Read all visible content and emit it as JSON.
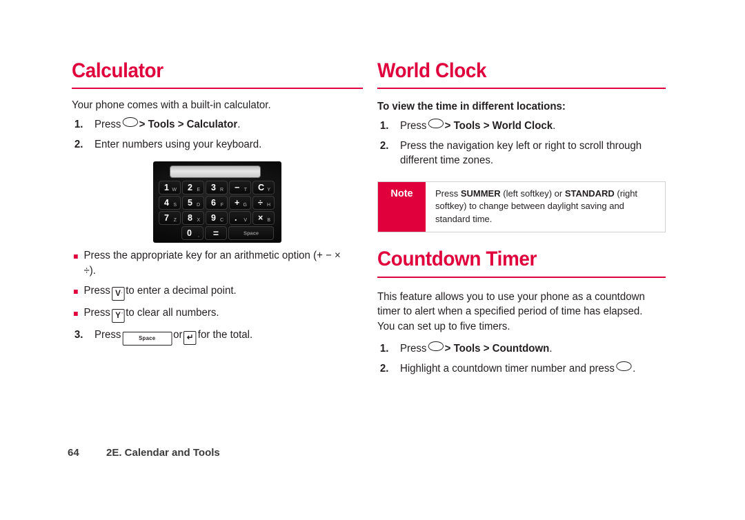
{
  "accent_color": "#e0003c",
  "left_column": {
    "heading": "Calculator",
    "intro": "Your phone comes with a built-in calculator.",
    "steps": [
      {
        "num": "1.",
        "prefix": "Press",
        "icon": "ok-key-icon",
        "path": "> Tools > Calculator",
        "suffix": "."
      },
      {
        "num": "2.",
        "text": "Enter numbers using your keyboard."
      }
    ],
    "keypad": {
      "display_value": "",
      "rows": [
        [
          {
            "main": "1",
            "sub": "W"
          },
          {
            "main": "2",
            "sub": "E"
          },
          {
            "main": "3",
            "sub": "R"
          },
          {
            "main": "−",
            "sub": "T"
          },
          {
            "main": "C",
            "sub": "Y"
          }
        ],
        [
          {
            "main": "4",
            "sub": "S"
          },
          {
            "main": "5",
            "sub": "D"
          },
          {
            "main": "6",
            "sub": "F"
          },
          {
            "main": "+",
            "sub": "G"
          },
          {
            "main": "÷",
            "sub": "H"
          }
        ],
        [
          {
            "main": "7",
            "sub": "Z"
          },
          {
            "main": "8",
            "sub": "X"
          },
          {
            "main": "9",
            "sub": "C"
          },
          {
            "main": ".",
            "sub": "V"
          },
          {
            "main": "×",
            "sub": "B"
          }
        ],
        [
          {
            "main": "0",
            "sub": ","
          },
          {
            "main": "=",
            "sub": ""
          },
          {
            "main": "Space",
            "sub": ""
          }
        ]
      ]
    },
    "bullets": [
      {
        "text_before": "Press the appropriate key for an arithmetic option (+ − × ÷).",
        "kind": "plain"
      },
      {
        "kind": "keycap",
        "prefix": "Press",
        "keycap": "V",
        "keycap_sup": "·",
        "suffix": "to enter a decimal point."
      },
      {
        "kind": "keycap",
        "prefix": "Press",
        "keycap": "Y",
        "keycap_sup": "’",
        "suffix": "to clear all numbers."
      }
    ],
    "final_step": {
      "num": "3.",
      "prefix": "Press",
      "key_space": "Space",
      "conjunction": "or",
      "key_enter": "↵",
      "suffix": "for the total."
    }
  },
  "right_column": {
    "world_clock": {
      "heading": "World Clock",
      "lead": "To view the time in different locations:",
      "steps": [
        {
          "num": "1.",
          "prefix": "Press",
          "icon": "ok-key-icon",
          "path": "> Tools > World Clock",
          "suffix": "."
        },
        {
          "num": "2.",
          "text": "Press the navigation key left or right to scroll through different time zones."
        }
      ],
      "note": {
        "label": "Note",
        "segments": [
          {
            "t": "Press ",
            "b": false
          },
          {
            "t": "SUMMER",
            "b": true
          },
          {
            "t": " (left softkey) or ",
            "b": false
          },
          {
            "t": "STANDARD",
            "b": true
          },
          {
            "t": " (right softkey) to change between daylight saving and standard time.",
            "b": false
          }
        ]
      }
    },
    "countdown_timer": {
      "heading": "Countdown Timer",
      "intro": "This feature allows you to use your phone as a countdown timer to alert when a specified period of time has elapsed. You can set up to five timers.",
      "steps": [
        {
          "num": "1.",
          "prefix": "Press",
          "icon": "ok-key-icon",
          "path": "> Tools > Countdown",
          "suffix": "."
        },
        {
          "num": "2.",
          "prefix": "Highlight a countdown timer number and press",
          "icon": "ok-key-icon",
          "suffix": "."
        }
      ]
    }
  },
  "footer": {
    "page_number": "64",
    "chapter": "2E. Calendar and Tools"
  }
}
